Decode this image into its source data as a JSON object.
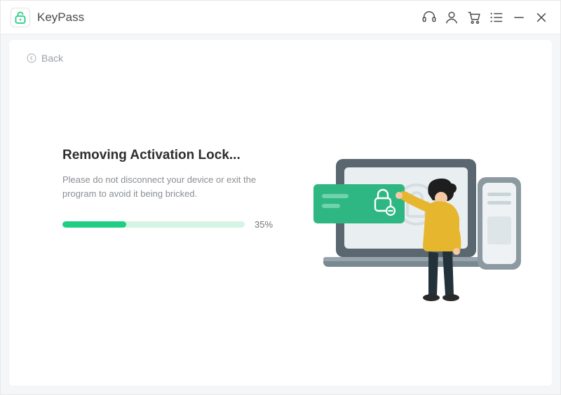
{
  "app": {
    "title": "KeyPass"
  },
  "titlebar_icons": {
    "support": "support-icon",
    "account": "account-icon",
    "cart": "cart-icon",
    "menu": "menu-icon",
    "minimize": "minimize-icon",
    "close": "close-icon"
  },
  "back": {
    "label": "Back"
  },
  "main": {
    "heading": "Removing Activation Lock...",
    "subtext": "Please do not disconnect your device or exit the program to avoid it being bricked.",
    "progress_percent": 35,
    "percent_label": "35%"
  },
  "colors": {
    "accent": "#1FCE82",
    "accent_light": "#D4F4E5",
    "popup_green": "#2FB783"
  }
}
